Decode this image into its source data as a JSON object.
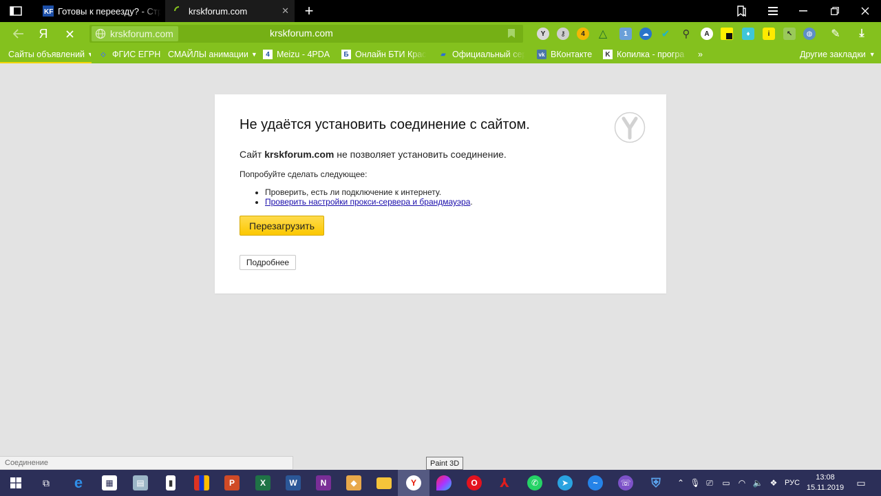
{
  "tabs": [
    {
      "title": "Готовы к переезду? - Стра",
      "active": false
    },
    {
      "title": "krskforum.com",
      "active": true
    }
  ],
  "omnibox": {
    "site_chip": "krskforum.com",
    "url": "krskforum.com"
  },
  "extensions": [
    "ext-1",
    "ext-2",
    "ext-3",
    "ext-4",
    "ext-5",
    "ext-6",
    "ext-7",
    "ext-8",
    "ext-9",
    "ext-10",
    "ext-11",
    "ext-12",
    "ext-13",
    "ext-14",
    "ext-15"
  ],
  "bookmarks": [
    {
      "label": "Сайты объявлений",
      "dropdown": true
    },
    {
      "label": "ФГИС ЕГРН"
    },
    {
      "label": "СМАЙЛЫ анимации",
      "dropdown": true
    },
    {
      "label": "Meizu - 4PDA"
    },
    {
      "label": "Онлайн БТИ Крас"
    },
    {
      "label": "Официальный сер"
    },
    {
      "label": "ВКонтакте"
    },
    {
      "label": "Копилка - програ"
    }
  ],
  "bookmarks_more": "»",
  "bookmarks_other": "Другие закладки",
  "error": {
    "heading": "Не удаётся установить соединение с сайтом.",
    "msg_prefix": "Сайт ",
    "msg_site": "krskforum.com",
    "msg_suffix": " не позволяет установить соединение.",
    "try_label": "Попробуйте сделать следующее:",
    "suggestion_1": "Проверить, есть ли подключение к интернету.",
    "suggestion_2": "Проверить настройки прокси-сервера и брандмауэра",
    "suggestion_2_end": ".",
    "reload_label": "Перезагрузить",
    "details_label": "Подробнее"
  },
  "status_text": "Соединение",
  "tooltip": "Paint 3D",
  "tray": {
    "lang": "РУС",
    "time": "13:08",
    "date": "15.11.2019"
  },
  "colors": {
    "toolbar": "#84c11e",
    "taskbar": "#2c2f58",
    "reload_button": "#fcc800",
    "page_bg": "#e3e3e3"
  }
}
